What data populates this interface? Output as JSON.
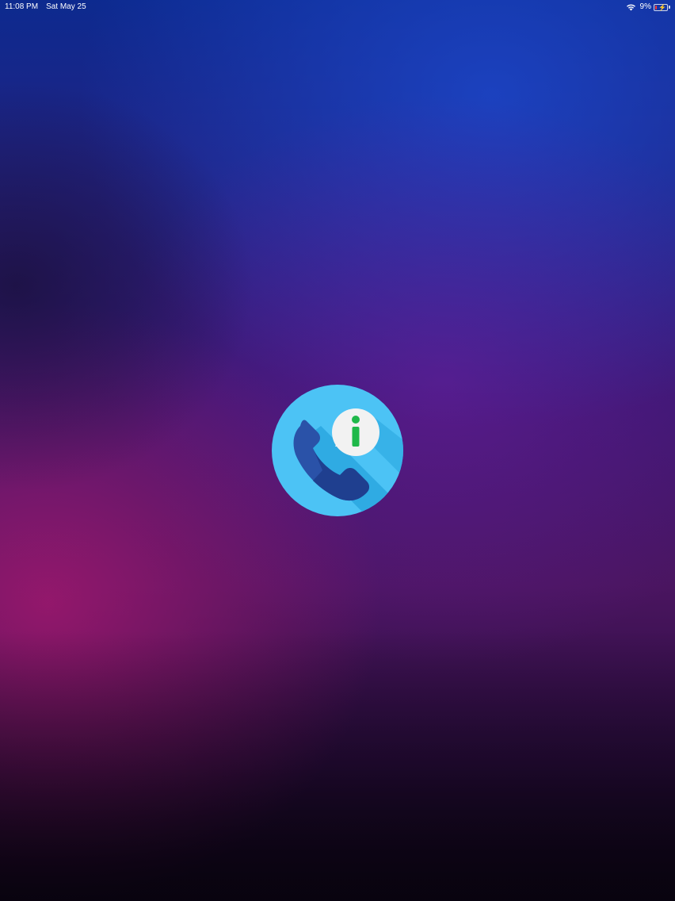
{
  "status_bar": {
    "time": "11:08 PM",
    "date": "Sat May 25",
    "battery_percent": "9%",
    "wifi_icon": "wifi-icon",
    "battery_icon": "battery-charging-icon"
  },
  "splash": {
    "logo_icon": "phone-info-icon",
    "colors": {
      "circle": "#4cc3f5",
      "phone": "#2a52a8",
      "bubble": "#f2f2f2",
      "info_glyph": "#1fb84a"
    }
  }
}
